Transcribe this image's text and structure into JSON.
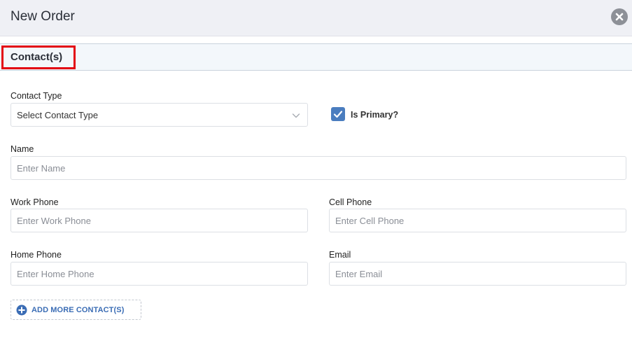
{
  "header": {
    "title": "New Order",
    "close_icon": "close-circle-icon"
  },
  "section": {
    "title": "Contact(s)",
    "highlight_color": "#e30613"
  },
  "form": {
    "contact_type": {
      "label": "Contact Type",
      "value": "Select Contact Type"
    },
    "is_primary": {
      "label": "Is Primary?",
      "checked": true
    },
    "name": {
      "label": "Name",
      "placeholder": "Enter Name"
    },
    "work_phone": {
      "label": "Work Phone",
      "placeholder": "Enter Work Phone"
    },
    "cell_phone": {
      "label": "Cell Phone",
      "placeholder": "Enter Cell Phone"
    },
    "home_phone": {
      "label": "Home Phone",
      "placeholder": "Enter Home Phone"
    },
    "email": {
      "label": "Email",
      "placeholder": "Enter Email"
    }
  },
  "add_more": {
    "label": "ADD MORE CONTACT(S)",
    "icon": "plus-circle-icon"
  },
  "colors": {
    "accent": "#4a7dbf",
    "link": "#3b6db5",
    "header_bg": "#eff0f5",
    "section_bg": "#f3f7fb"
  }
}
